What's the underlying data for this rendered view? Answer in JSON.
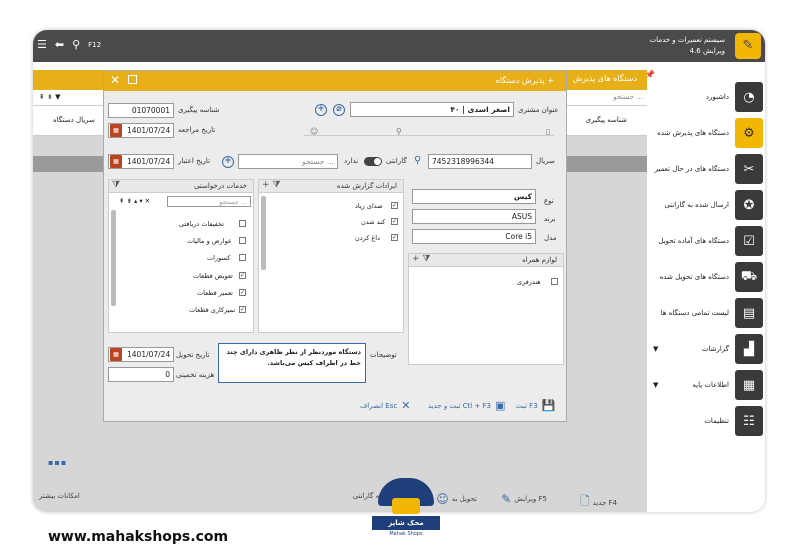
{
  "app": {
    "title": "سیستم تعمیرات و خدمات",
    "version": "ویرایش 4.6",
    "f12": "F12"
  },
  "sidebar": {
    "items": [
      {
        "label": "داشبورد",
        "icon": "dashboard-icon"
      },
      {
        "label": "دستگاه های پذیرش شده",
        "icon": "devices-icon"
      },
      {
        "label": "دستگاه های در حال تعمیر",
        "icon": "tools-icon"
      },
      {
        "label": "ارسال شده به گارانتی",
        "icon": "award-icon"
      },
      {
        "label": "دستگاه های آماده تحویل",
        "icon": "checklist-icon"
      },
      {
        "label": "دستگاه های تحویل شده",
        "icon": "delivered-icon"
      },
      {
        "label": "لیست تمامی دستگاه ها",
        "icon": "list-icon"
      },
      {
        "label": "گزارشات",
        "icon": "chart-icon"
      },
      {
        "label": "اطلاعات پایه",
        "icon": "document-icon"
      },
      {
        "label": "تنظیمات",
        "icon": "settings-icon"
      }
    ]
  },
  "main": {
    "header": "دستگاه های پذیرش",
    "search_placeholder": "جستجو ...",
    "col_tracking": "شناسه پیگیری",
    "col_serial": "سریال دستگاه"
  },
  "dialog": {
    "title": "پذیرش دستگاه +",
    "tracking_label": "شناسه پیگیری",
    "tracking_value": "01070001",
    "return_date_label": "تاریخ مراجعه",
    "return_date_value": "1401/07/24",
    "customer_label": "عنوان مشتری",
    "customer_value": "۴۰ | اصغر اسدی",
    "serial_label": "سریال",
    "serial_value": "7452318996344",
    "warranty_label": "گارانتی",
    "no_warranty": "ندارد",
    "search_placeholder": "جستجو ...",
    "expiry_label": "تاریخ اعتبار",
    "expiry_value": "1401/07/24",
    "type_label": "نوع",
    "type_value": "کیس",
    "brand_label": "برند",
    "brand_value": "ASUS",
    "model_label": "مدل",
    "model_value": "Core i5",
    "issues_title": "ایرادات گزارش شده",
    "issues": [
      "صدای زیاد",
      "کند شدن",
      "داغ کردن"
    ],
    "services_title": "خدمات درخواستی",
    "services_search": "جستجو ...",
    "services": [
      {
        "label": "تخفیفات دریافتی",
        "checked": false
      },
      {
        "label": "عوارض و مالیات",
        "checked": false
      },
      {
        "label": "کسورات",
        "checked": false
      },
      {
        "label": "تعویض قطعات",
        "checked": true
      },
      {
        "label": "تعمیر قطعات",
        "checked": true
      },
      {
        "label": "تمیزکاری قطعات",
        "checked": true
      }
    ],
    "accessories_title": "لوازم همراه",
    "accessories": [
      "هندزفری"
    ],
    "desc_label": "توضیحات",
    "desc_value": "دستگاه موردنظر از نظر ظاهری دارای چند خط در اطراف کیس می‌باشد.",
    "delivery_date_label": "تاریخ تحویل",
    "delivery_date_value": "1401/07/24",
    "estimated_cost_label": "هزینه تخمینی",
    "estimated_cost_value": "0",
    "save_label": "ثبت F3",
    "save_new_label": "ثبت و جدید Ctl + F3",
    "cancel_label": "انصراف Esc"
  },
  "bottombar": {
    "new": "جدید F4",
    "edit": "ویرایش F5",
    "deliver": "تحویل به",
    "warranty": "به گارانتی F6",
    "extras": "امکانات بیشتر"
  },
  "footer": {
    "url": "www.mahakshops.com",
    "logo_fa": "محک شاپز",
    "logo_en": "Mahak Shops"
  }
}
